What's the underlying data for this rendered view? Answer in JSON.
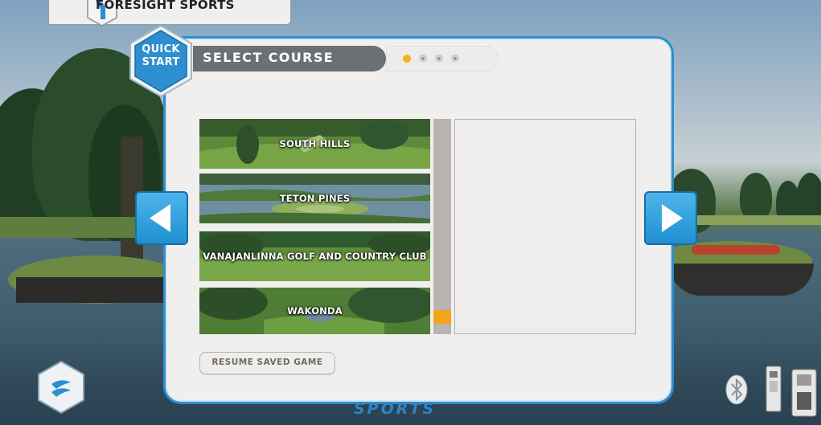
{
  "app": {
    "brand": "FORESIGHT SPORTS",
    "brand_footer": "SPORTS"
  },
  "header": {
    "quickstart_line1": "QUICK",
    "quickstart_line2": "START",
    "title": "SELECT COURSE",
    "steps": {
      "total": 4,
      "active_index": 0
    }
  },
  "courses": [
    {
      "name": "SOUTH HILLS"
    },
    {
      "name": "TETON PINES"
    },
    {
      "name": "VANAJANLINNA GOLF AND COUNTRY CLUB"
    },
    {
      "name": "WAKONDA"
    }
  ],
  "scroll": {
    "position": 0.9
  },
  "buttons": {
    "resume": "RESUME SAVED GAME"
  },
  "icons": {
    "prev": "chevron-left-icon",
    "next": "chevron-right-icon",
    "bluetooth": "bluetooth-icon",
    "brand": "foresight-logo-icon",
    "device_launch_monitor": "launch-monitor-icon",
    "device_hub": "device-hub-icon"
  },
  "colors": {
    "accent_blue": "#2b8fd1",
    "accent_orange": "#f5b21d",
    "header_grey": "#6a7074"
  }
}
